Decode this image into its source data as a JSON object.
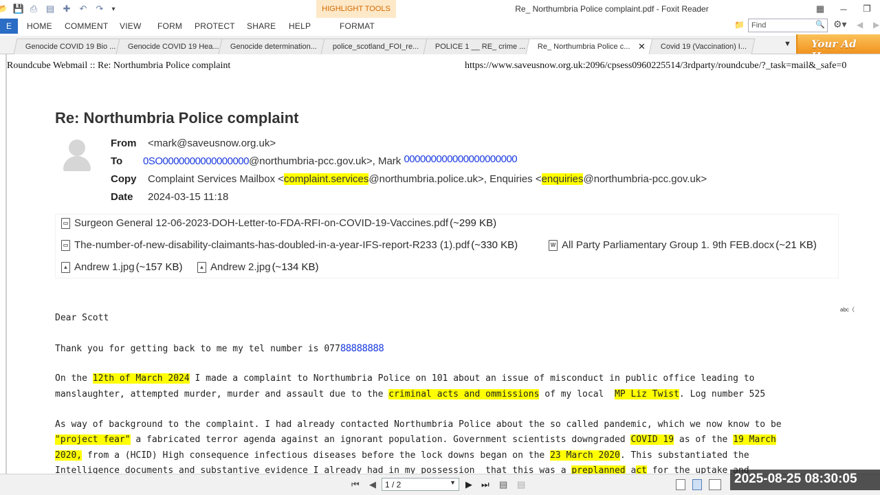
{
  "titlebar": {
    "highlight_tools": "HIGHLIGHT TOOLS",
    "title": "Re_ Northumbria Police complaint.pdf - Foxit Reader"
  },
  "menu": {
    "file": "E",
    "items": [
      "HOME",
      "COMMENT",
      "VIEW",
      "FORM",
      "PROTECT",
      "SHARE",
      "HELP",
      "FORMAT"
    ],
    "find_placeholder": "Find"
  },
  "tabs": [
    {
      "label": "Genocide COVID 19 Bio ...",
      "active": false
    },
    {
      "label": "Genocide COVID 19 Hea...",
      "active": false
    },
    {
      "label": "Genocide determination...",
      "active": false
    },
    {
      "label": "police_scotland_FOI_re...",
      "active": false
    },
    {
      "label": "POLICE 1 __ RE_ crime ...",
      "active": false
    },
    {
      "label": "Re_ Northumbria Police c...",
      "active": true
    },
    {
      "label": "Covid 19 (Vaccination) I...",
      "active": false
    }
  ],
  "ad_text": "Your Ad Here",
  "page": {
    "header_left": "Roundcube Webmail :: Re: Northumbria Police complaint",
    "header_right": "https://www.saveusnow.org.uk:2096/cpsess0960225514/3rdparty/roundcube/?_task=mail&_safe=0",
    "subject": "Re: Northumbria Police complaint",
    "from_label": "From",
    "from_value": "<mark@saveusnow.org.uk>",
    "to_label": "To",
    "to_redacted_1": "0SO0000000000000000",
    "to_mid": "@northumbria-pcc.gov.uk>, Mark ",
    "to_redacted_2": "000000000000000000000",
    "copy_label": "Copy",
    "copy_part1": "Complaint Services Mailbox <",
    "copy_hl1": "complaint.services",
    "copy_part2": "@northumbria.police.uk>, Enquiries <",
    "copy_hl2": "enquiries",
    "copy_part3": "@northumbria-pcc.gov.uk>",
    "date_label": "Date",
    "date_value": "2024-03-15 11:18"
  },
  "attachments": [
    {
      "name": "Surgeon General 12-06-2023-DOH-Letter-to-FDA-RFI-on-COVID-19-Vaccines.pdf",
      "size": "(~299 KB)",
      "icon": "pdf-icon"
    },
    {
      "name": "The-number-of-new-disability-claimants-has-doubled-in-a-year-IFS-report-R233 (1).pdf",
      "size": "(~330 KB)",
      "icon": "pdf-icon"
    },
    {
      "name": "All Party Parliamentary Group 1. 9th FEB.docx",
      "size": "(~21 KB)",
      "icon": "word-icon"
    },
    {
      "name": "Andrew 1.jpg",
      "size": "(~157 KB)",
      "icon": "image-icon"
    },
    {
      "name": "Andrew 2.jpg",
      "size": "(~134 KB)",
      "icon": "image-icon"
    }
  ],
  "body": {
    "greeting": "Dear Scott",
    "thanks": "Thank you for getting back to me my tel number is 077",
    "tel_redacted": "88888888",
    "p1_a": "On the ",
    "p1_hl1": "12th of March 2024",
    "p1_b": " I made a complaint to Northumbria Police on 101 about an issue of misconduct in public office leading to",
    "p1_c": "manslaughter, attempted murder, murder and assault due to the ",
    "p1_hl2": "criminal acts and ommissions",
    "p1_d": " of my local  ",
    "p1_hl3": "MP Liz Twist",
    "p1_e": ". Log number 525",
    "p2_a": "As way of background to the complaint. I had already contacted Northumbria Police about the so called pandemic, which we now know to be",
    "p2_hl1": "\"project fear\"",
    "p2_b": " a fabricated terror agenda against an ignorant population. Government scientists downgraded ",
    "p2_hl2": "COVID 19",
    "p2_c": " as of the ",
    "p2_hl3": "19 March",
    "p2_hl4": "2020,",
    "p2_d": " from a (HCID) High consequence infectious diseases before the lock downs began on the ",
    "p2_hl5": "23 March 2020",
    "p2_e": ". This substantiated the",
    "p2_f": "Intelligence documents and substantive evidence I already had in my possession  that this was a ",
    "p2_hl6": "preplanned",
    "p2_g": " a",
    "p2_hl7": "ct",
    "p2_h": " for the uptake and"
  },
  "status": {
    "page_indicator": "1 / 2",
    "timestamp": "2025-08-25  08:30:05"
  }
}
